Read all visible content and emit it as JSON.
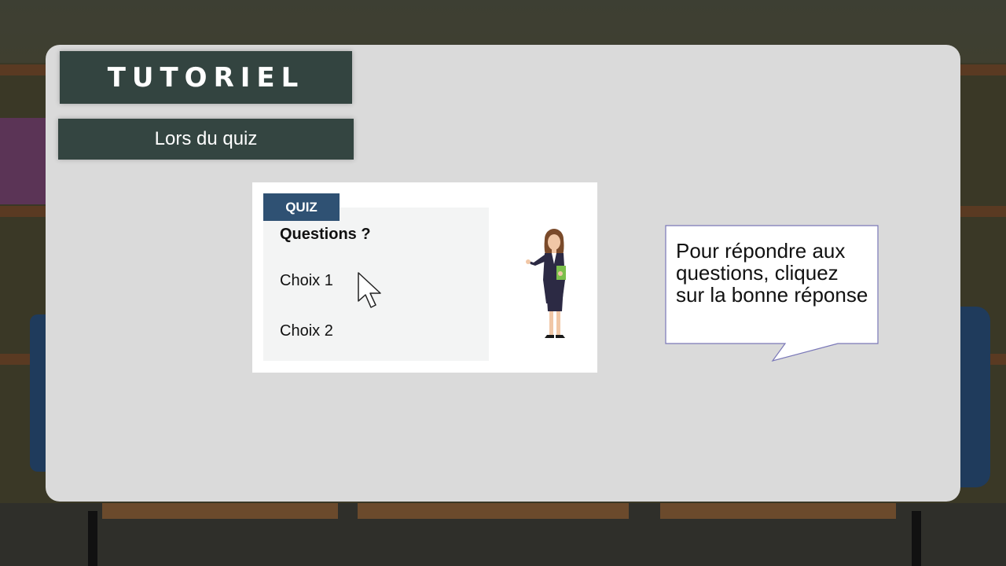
{
  "slide": {
    "title": "TUTORIEL",
    "subtitle": "Lors du quiz"
  },
  "quiz": {
    "tag": "QUIZ",
    "question": "Questions ?",
    "choices": [
      "Choix 1",
      "Choix 2"
    ]
  },
  "speech_bubble": {
    "text": "Pour répondre aux questions, cliquez sur la bonne réponse"
  },
  "icons": {
    "cursor": "mouse-pointer-icon",
    "character": "presenter-woman-illustration"
  },
  "colors": {
    "title_bg": "#334440",
    "panel_bg": "#dadada",
    "quiz_tag_bg": "#2f5173",
    "bubble_border": "#7a78b8"
  }
}
